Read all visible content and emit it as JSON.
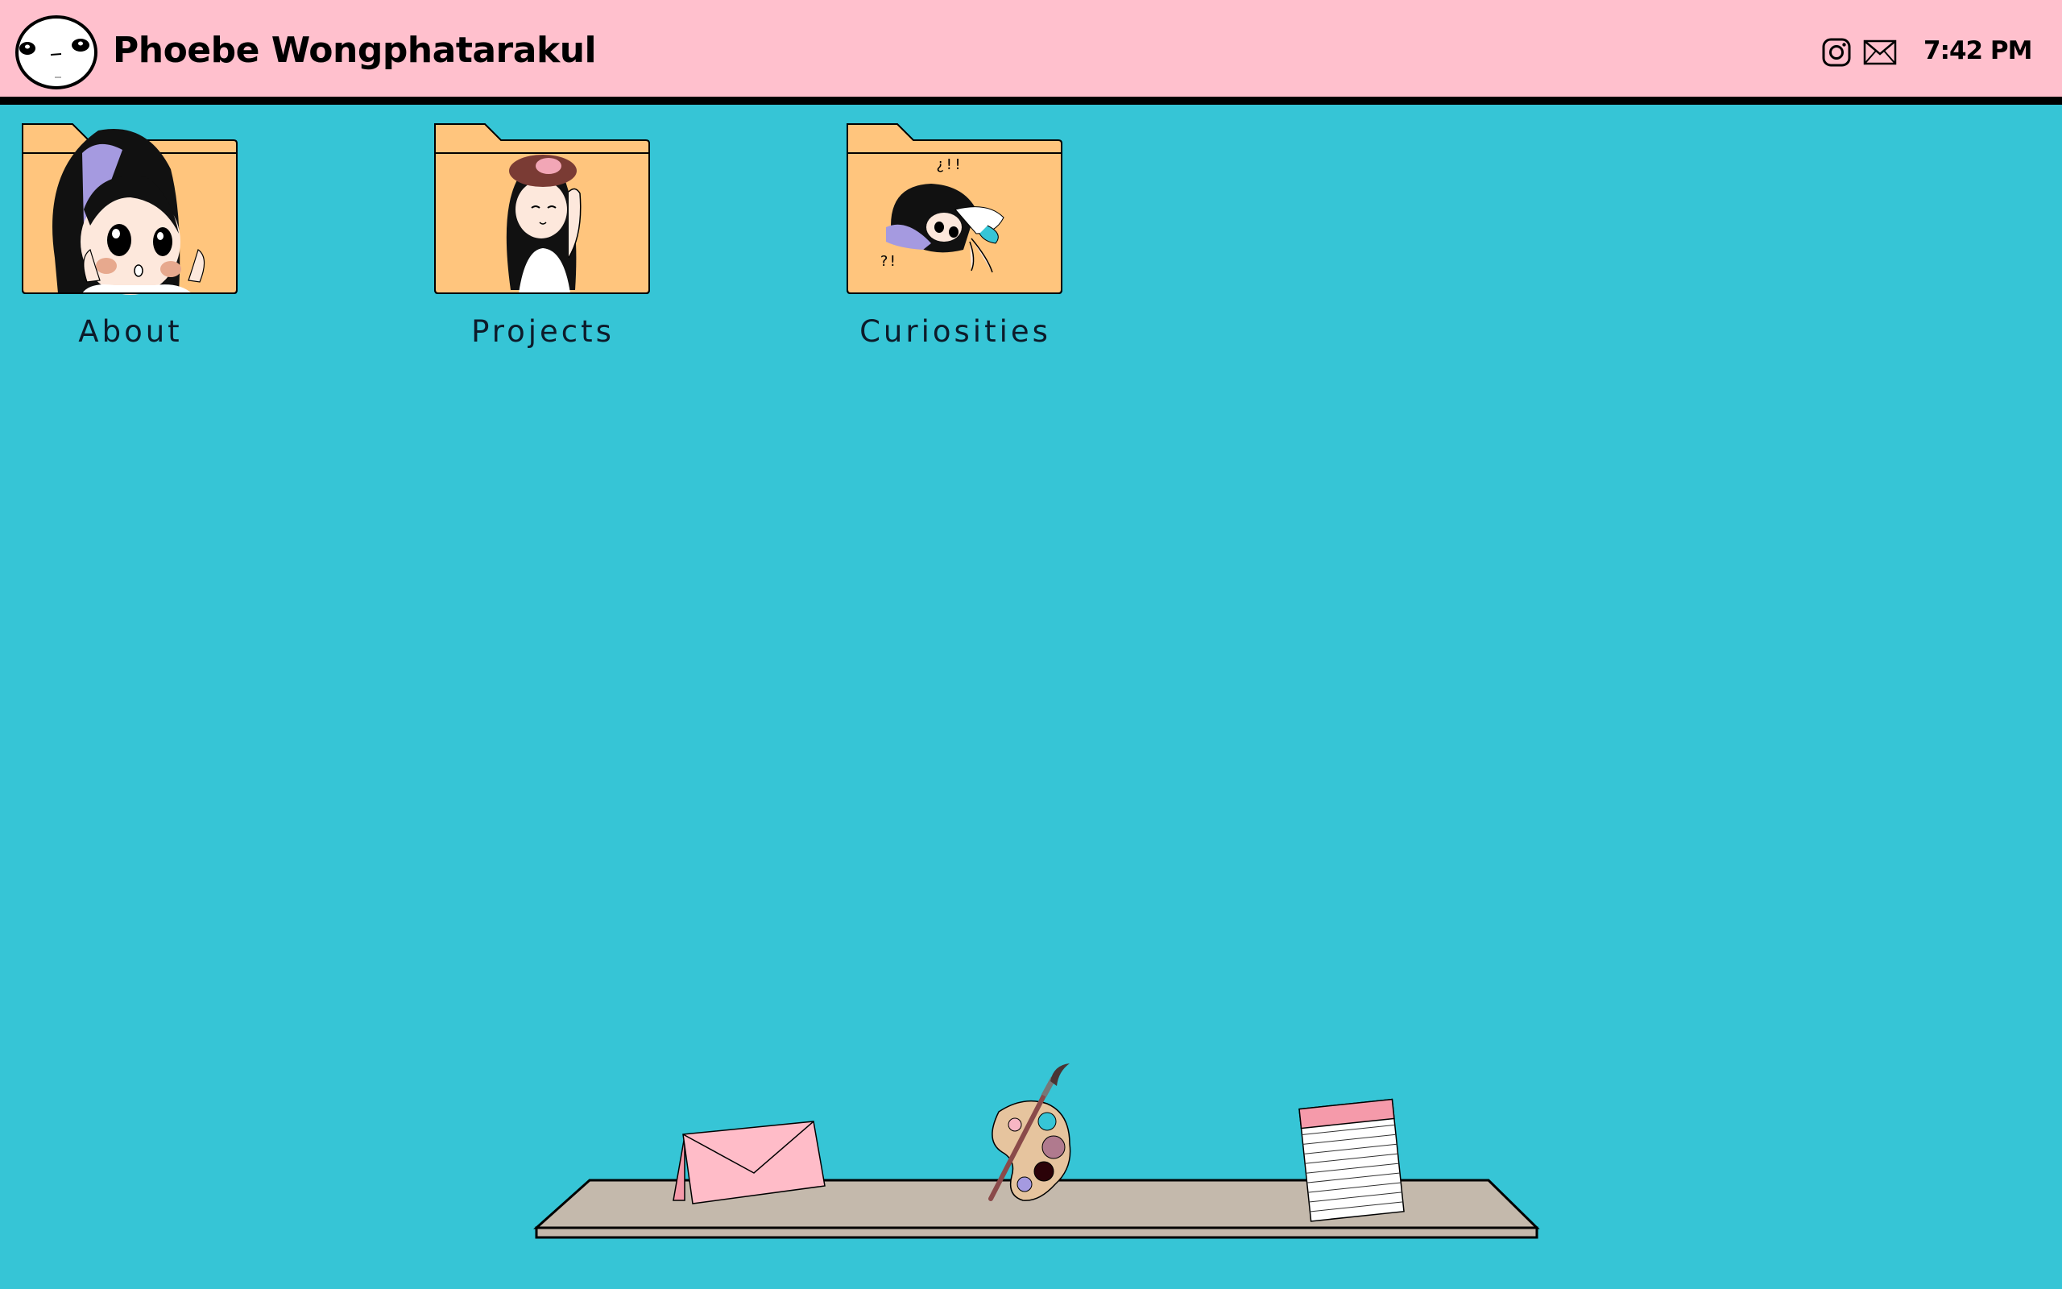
{
  "header": {
    "site_name": "Phoebe Wongphatarakul",
    "clock": "7:42 PM",
    "avatar_icon": "face-avatar-icon",
    "social_icons": [
      "instagram-icon",
      "mail-icon"
    ]
  },
  "folders": [
    {
      "label": "About",
      "icon": "folder-about-icon"
    },
    {
      "label": "Projects",
      "icon": "folder-projects-icon"
    },
    {
      "label": "Curiosities",
      "icon": "folder-curiosities-icon"
    }
  ],
  "shelf": {
    "items": [
      "envelope-icon",
      "paint-palette-icon",
      "notepad-icon"
    ]
  },
  "colors": {
    "desktop": "#36c5d6",
    "topbar": "#ffc0cd",
    "folder": "#ffc57d",
    "shelf": "#c4b9ac",
    "envelope": "#ffbcc8"
  }
}
